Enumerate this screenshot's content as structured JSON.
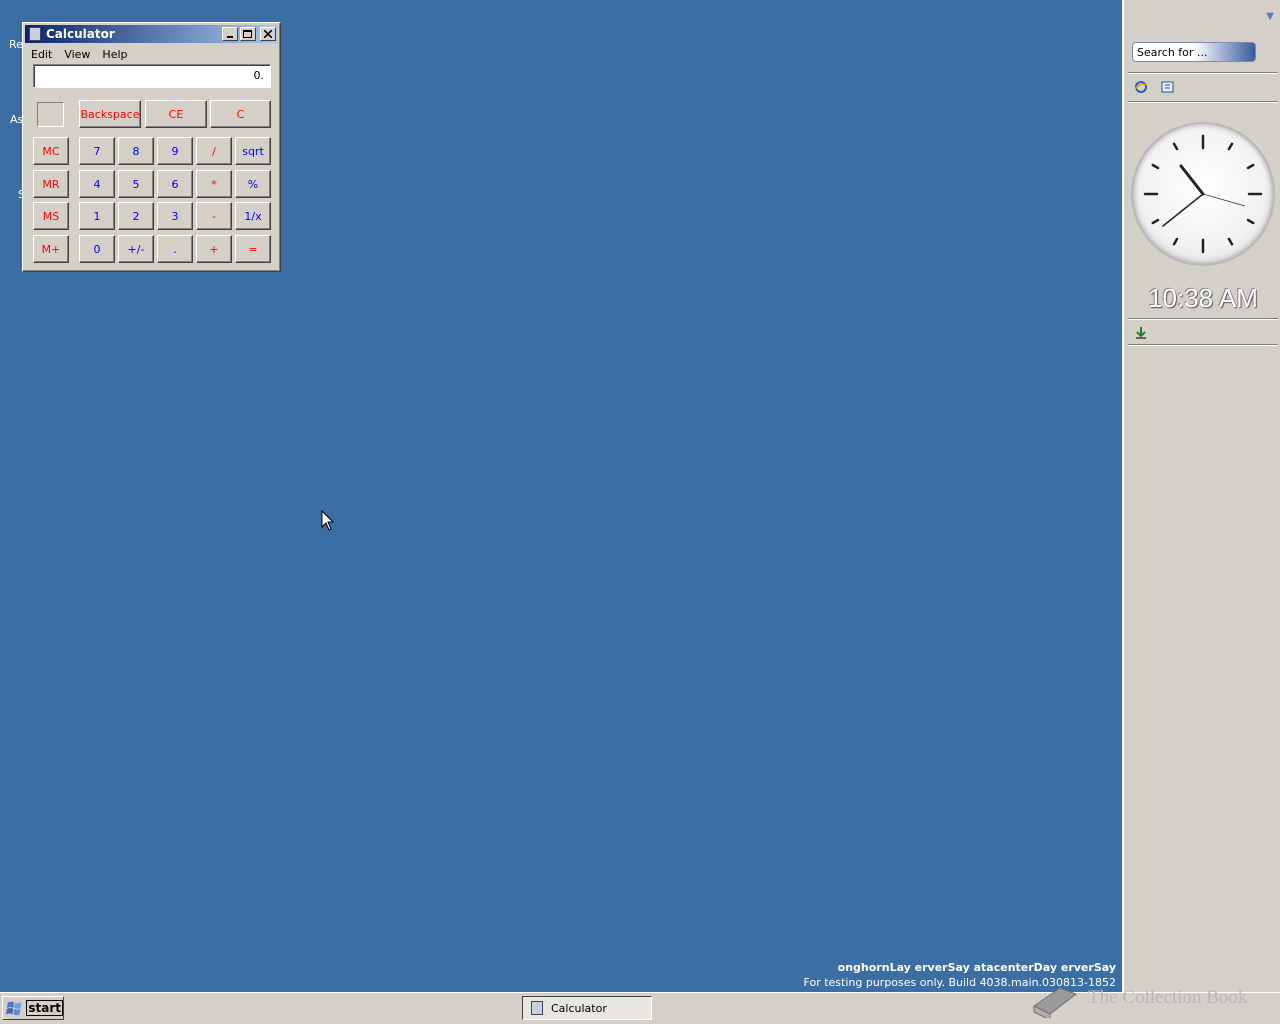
{
  "desktop": {
    "icon_fragments": [
      "Re",
      "As",
      "S"
    ],
    "watermark_line1": "onghornLay erverSay atacenterDay erverSay",
    "watermark_line2": "For testing purposes only. Build 4038.main.030813-1852",
    "background_color": "#3b6ea5"
  },
  "calculator": {
    "title": "Calculator",
    "menu": [
      "Edit",
      "View",
      "Help"
    ],
    "display_value": "0.",
    "control_buttons": [
      "Backspace",
      "CE",
      "C"
    ],
    "memory_buttons": [
      "MC",
      "MR",
      "MS",
      "M+"
    ],
    "rows": [
      [
        "7",
        "8",
        "9",
        "/",
        "sqrt"
      ],
      [
        "4",
        "5",
        "6",
        "*",
        "%"
      ],
      [
        "1",
        "2",
        "3",
        "-",
        "1/x"
      ],
      [
        "0",
        "+/-",
        ".",
        "+",
        "="
      ]
    ]
  },
  "sidebar": {
    "search_placeholder": "Search for ...",
    "clock_time": "10:38 AM",
    "icons": [
      "internet-explorer-icon",
      "outlook-express-icon",
      "download-icon"
    ]
  },
  "taskbar": {
    "start_label": "start",
    "task_items": [
      "Calculator"
    ],
    "tray_text": "The Collection Book"
  }
}
